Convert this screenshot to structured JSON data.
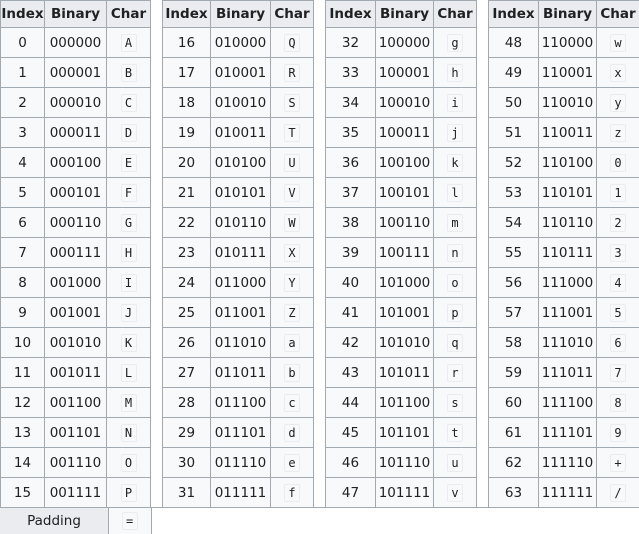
{
  "headers": [
    "Index",
    "Binary",
    "Char"
  ],
  "groups": [
    [
      {
        "index": "0",
        "binary": "000000",
        "char": "A"
      },
      {
        "index": "1",
        "binary": "000001",
        "char": "B"
      },
      {
        "index": "2",
        "binary": "000010",
        "char": "C"
      },
      {
        "index": "3",
        "binary": "000011",
        "char": "D"
      },
      {
        "index": "4",
        "binary": "000100",
        "char": "E"
      },
      {
        "index": "5",
        "binary": "000101",
        "char": "F"
      },
      {
        "index": "6",
        "binary": "000110",
        "char": "G"
      },
      {
        "index": "7",
        "binary": "000111",
        "char": "H"
      },
      {
        "index": "8",
        "binary": "001000",
        "char": "I"
      },
      {
        "index": "9",
        "binary": "001001",
        "char": "J"
      },
      {
        "index": "10",
        "binary": "001010",
        "char": "K"
      },
      {
        "index": "11",
        "binary": "001011",
        "char": "L"
      },
      {
        "index": "12",
        "binary": "001100",
        "char": "M"
      },
      {
        "index": "13",
        "binary": "001101",
        "char": "N"
      },
      {
        "index": "14",
        "binary": "001110",
        "char": "O"
      },
      {
        "index": "15",
        "binary": "001111",
        "char": "P"
      }
    ],
    [
      {
        "index": "16",
        "binary": "010000",
        "char": "Q"
      },
      {
        "index": "17",
        "binary": "010001",
        "char": "R"
      },
      {
        "index": "18",
        "binary": "010010",
        "char": "S"
      },
      {
        "index": "19",
        "binary": "010011",
        "char": "T"
      },
      {
        "index": "20",
        "binary": "010100",
        "char": "U"
      },
      {
        "index": "21",
        "binary": "010101",
        "char": "V"
      },
      {
        "index": "22",
        "binary": "010110",
        "char": "W"
      },
      {
        "index": "23",
        "binary": "010111",
        "char": "X"
      },
      {
        "index": "24",
        "binary": "011000",
        "char": "Y"
      },
      {
        "index": "25",
        "binary": "011001",
        "char": "Z"
      },
      {
        "index": "26",
        "binary": "011010",
        "char": "a"
      },
      {
        "index": "27",
        "binary": "011011",
        "char": "b"
      },
      {
        "index": "28",
        "binary": "011100",
        "char": "c"
      },
      {
        "index": "29",
        "binary": "011101",
        "char": "d"
      },
      {
        "index": "30",
        "binary": "011110",
        "char": "e"
      },
      {
        "index": "31",
        "binary": "011111",
        "char": "f"
      }
    ],
    [
      {
        "index": "32",
        "binary": "100000",
        "char": "g"
      },
      {
        "index": "33",
        "binary": "100001",
        "char": "h"
      },
      {
        "index": "34",
        "binary": "100010",
        "char": "i"
      },
      {
        "index": "35",
        "binary": "100011",
        "char": "j"
      },
      {
        "index": "36",
        "binary": "100100",
        "char": "k"
      },
      {
        "index": "37",
        "binary": "100101",
        "char": "l"
      },
      {
        "index": "38",
        "binary": "100110",
        "char": "m"
      },
      {
        "index": "39",
        "binary": "100111",
        "char": "n"
      },
      {
        "index": "40",
        "binary": "101000",
        "char": "o"
      },
      {
        "index": "41",
        "binary": "101001",
        "char": "p"
      },
      {
        "index": "42",
        "binary": "101010",
        "char": "q"
      },
      {
        "index": "43",
        "binary": "101011",
        "char": "r"
      },
      {
        "index": "44",
        "binary": "101100",
        "char": "s"
      },
      {
        "index": "45",
        "binary": "101101",
        "char": "t"
      },
      {
        "index": "46",
        "binary": "101110",
        "char": "u"
      },
      {
        "index": "47",
        "binary": "101111",
        "char": "v"
      }
    ],
    [
      {
        "index": "48",
        "binary": "110000",
        "char": "w"
      },
      {
        "index": "49",
        "binary": "110001",
        "char": "x"
      },
      {
        "index": "50",
        "binary": "110010",
        "char": "y"
      },
      {
        "index": "51",
        "binary": "110011",
        "char": "z"
      },
      {
        "index": "52",
        "binary": "110100",
        "char": "0"
      },
      {
        "index": "53",
        "binary": "110101",
        "char": "1"
      },
      {
        "index": "54",
        "binary": "110110",
        "char": "2"
      },
      {
        "index": "55",
        "binary": "110111",
        "char": "3"
      },
      {
        "index": "56",
        "binary": "111000",
        "char": "4"
      },
      {
        "index": "57",
        "binary": "111001",
        "char": "5"
      },
      {
        "index": "58",
        "binary": "111010",
        "char": "6"
      },
      {
        "index": "59",
        "binary": "111011",
        "char": "7"
      },
      {
        "index": "60",
        "binary": "111100",
        "char": "8"
      },
      {
        "index": "61",
        "binary": "111101",
        "char": "9"
      },
      {
        "index": "62",
        "binary": "111110",
        "char": "+"
      },
      {
        "index": "63",
        "binary": "111111",
        "char": "/"
      }
    ]
  ],
  "padding": {
    "label": "Padding",
    "char": "="
  }
}
